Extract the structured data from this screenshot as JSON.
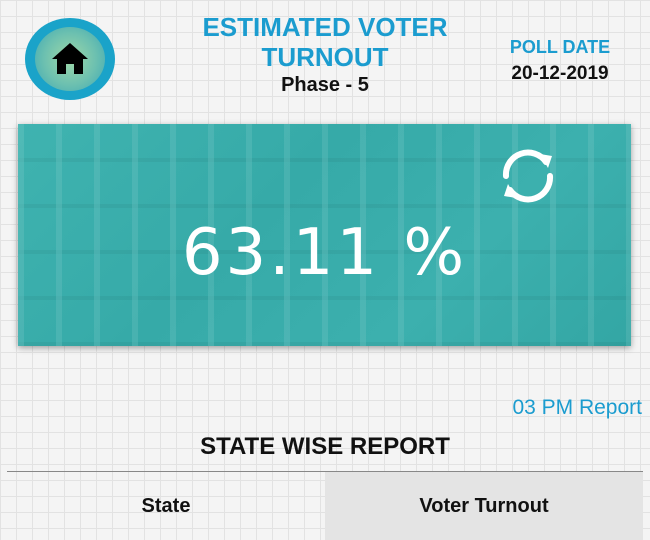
{
  "header": {
    "title": "ESTIMATED VOTER TURNOUT",
    "phase": "Phase - 5",
    "poll_date_label": "POLL DATE",
    "poll_date": "20-12-2019",
    "home_icon": "home-icon"
  },
  "summary": {
    "turnout": "63.11 %",
    "refresh_icon": "refresh-icon",
    "report_time": "03 PM Report"
  },
  "state_report": {
    "heading": "STATE WISE REPORT",
    "columns": [
      "State",
      "Voter Turnout"
    ]
  },
  "colors": {
    "accent": "#1b9ccf",
    "card": "#3cb0ae",
    "header_cell": "#e4e4e4"
  }
}
